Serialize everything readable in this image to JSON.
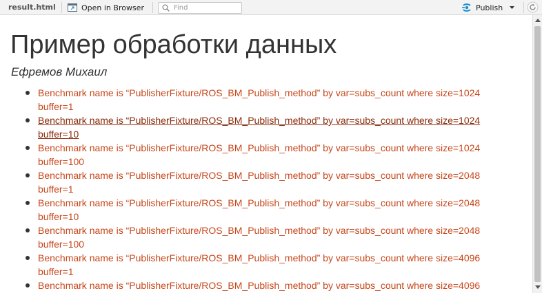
{
  "toolbar": {
    "file_name": "result.html",
    "open_in_browser": "Open in Browser",
    "find_placeholder": "Find",
    "publish": "Publish"
  },
  "page": {
    "title": "Пример обработки данных",
    "author": "Ефремов Михаил"
  },
  "links": [
    {
      "text": "Benchmark name is “PublisherFixture/ROS_BM_Publish_method” by var=subs_count where size=1024 buffer=1",
      "hover": false
    },
    {
      "text": "Benchmark name is “PublisherFixture/ROS_BM_Publish_method” by var=subs_count where size=1024 buffer=10",
      "hover": true
    },
    {
      "text": "Benchmark name is “PublisherFixture/ROS_BM_Publish_method” by var=subs_count where size=1024 buffer=100",
      "hover": false
    },
    {
      "text": "Benchmark name is “PublisherFixture/ROS_BM_Publish_method” by var=subs_count where size=2048 buffer=1",
      "hover": false
    },
    {
      "text": "Benchmark name is “PublisherFixture/ROS_BM_Publish_method” by var=subs_count where size=2048 buffer=10",
      "hover": false
    },
    {
      "text": "Benchmark name is “PublisherFixture/ROS_BM_Publish_method” by var=subs_count where size=2048 buffer=100",
      "hover": false
    },
    {
      "text": "Benchmark name is “PublisherFixture/ROS_BM_Publish_method” by var=subs_count where size=4096 buffer=1",
      "hover": false
    },
    {
      "text": "Benchmark name is “PublisherFixture/ROS_BM_Publish_method” by var=subs_count where size=4096",
      "hover": false
    }
  ],
  "colors": {
    "link": "#c7461a",
    "link_hover": "#8a2a0a",
    "heading": "#333333",
    "toolbar_bg": "#f3f3f3",
    "publish_icon": "#1a8ccf"
  }
}
